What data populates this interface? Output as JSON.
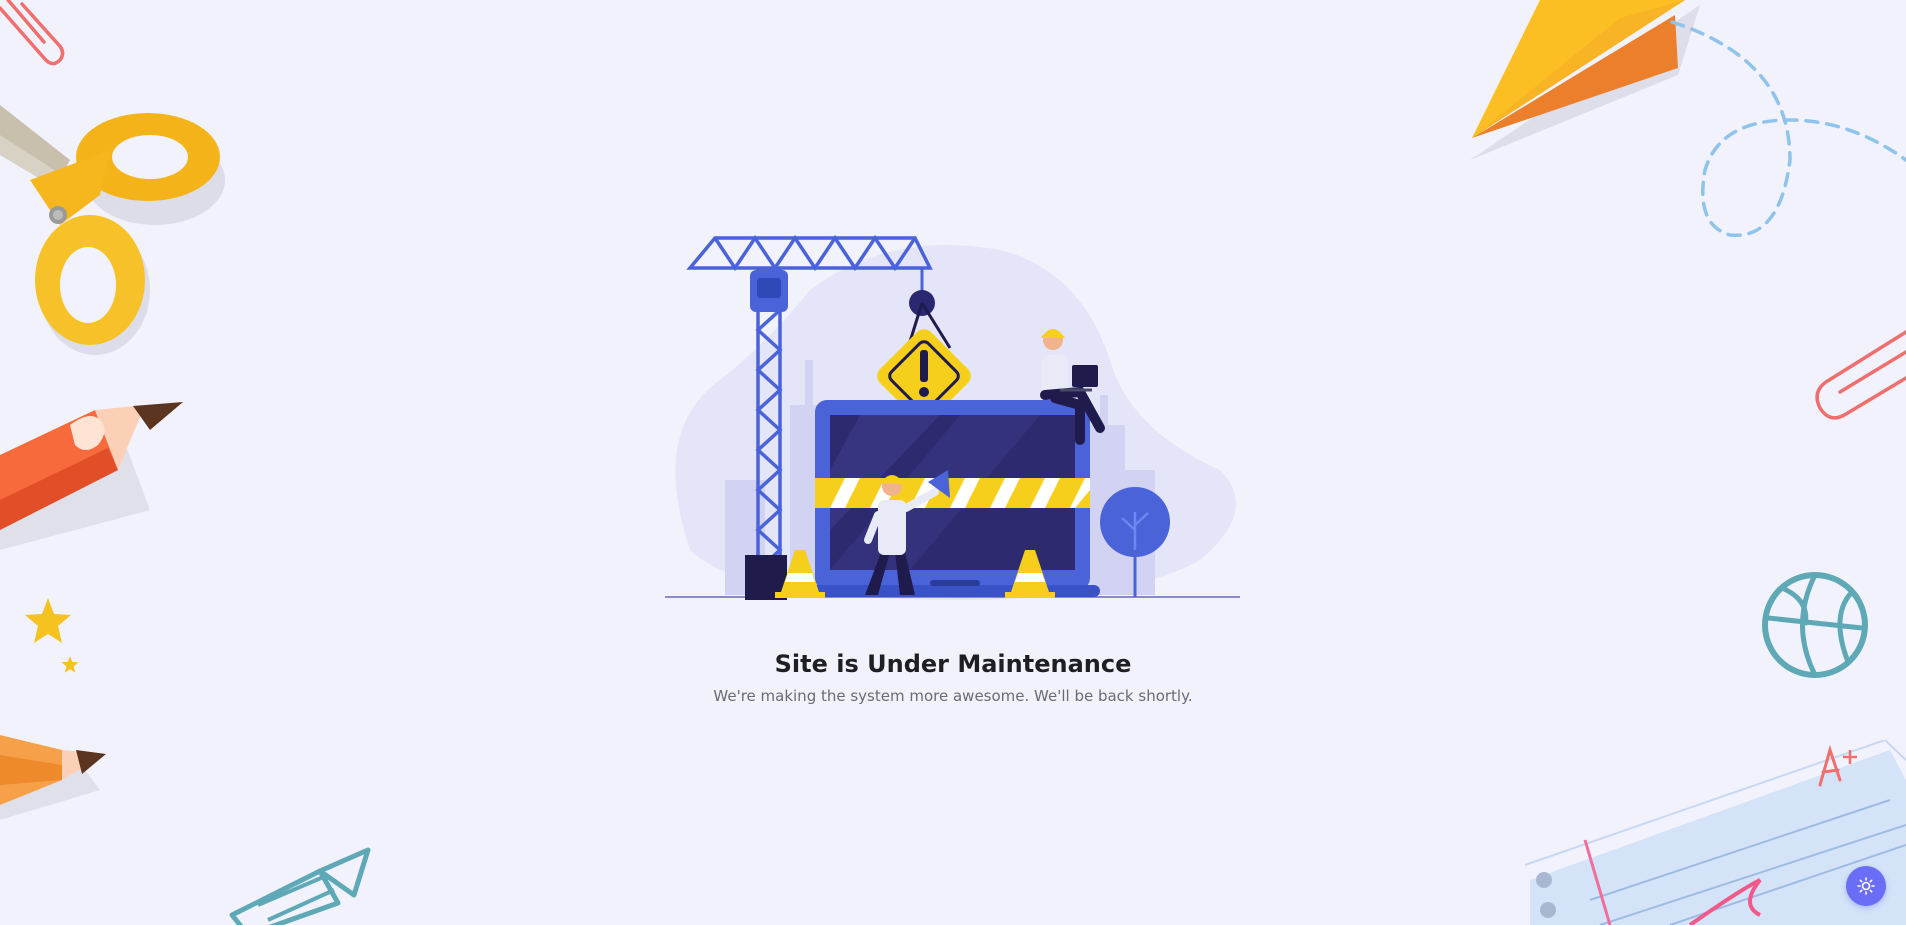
{
  "maintenance": {
    "title": "Site is Under Maintenance",
    "message": "We're making the system more awesome. We'll be back shortly."
  },
  "theme_toggle": {
    "icon": "sun-icon",
    "label": "Toggle theme"
  },
  "illustration": {
    "subject": "construction-crane-laptop-workers",
    "sign_glyph": "!"
  },
  "decorations": [
    "paperclip-icon",
    "scissors-icon",
    "pencil-icon",
    "star-icon",
    "paper-plane-icon",
    "basketball-icon",
    "notebook-icon"
  ],
  "colors": {
    "background": "#f2f2fc",
    "accent": "#6a6ef7",
    "crane": "#4a63d8",
    "warning": "#f6ce1c",
    "text": "#1f1f23",
    "muted_text": "#6b6b76"
  }
}
